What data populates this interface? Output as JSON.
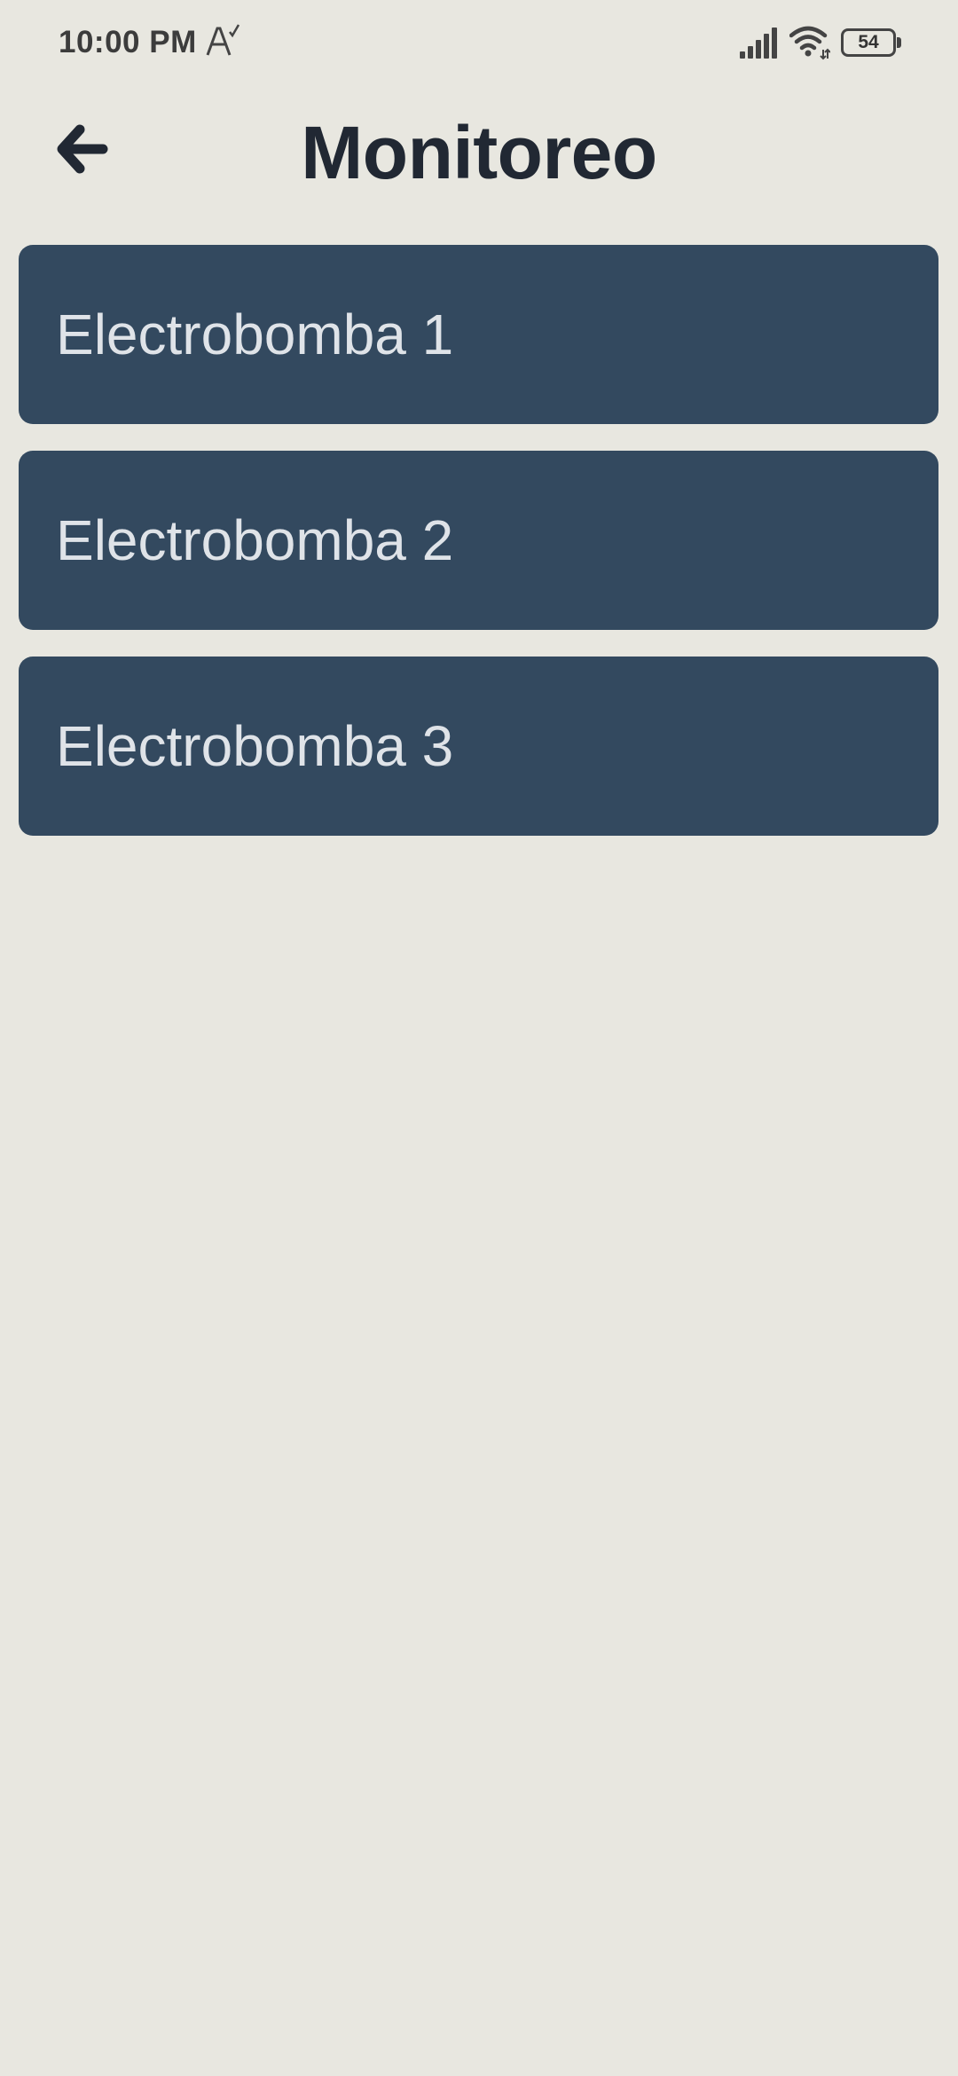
{
  "status_bar": {
    "time": "10:00 PM",
    "battery": "54",
    "icons": [
      "font-check-icon",
      "signal-icon",
      "wifi-icon",
      "battery-icon"
    ]
  },
  "header": {
    "title": "Monitoreo",
    "back_icon": "arrow-left-icon"
  },
  "pumps": [
    {
      "label": "Electrobomba 1"
    },
    {
      "label": "Electrobomba 2"
    },
    {
      "label": "Electrobomba 3"
    }
  ],
  "colors": {
    "background": "#e8e7e0",
    "card": "#33495f",
    "card_text": "#dfe3e8",
    "title": "#212833"
  }
}
